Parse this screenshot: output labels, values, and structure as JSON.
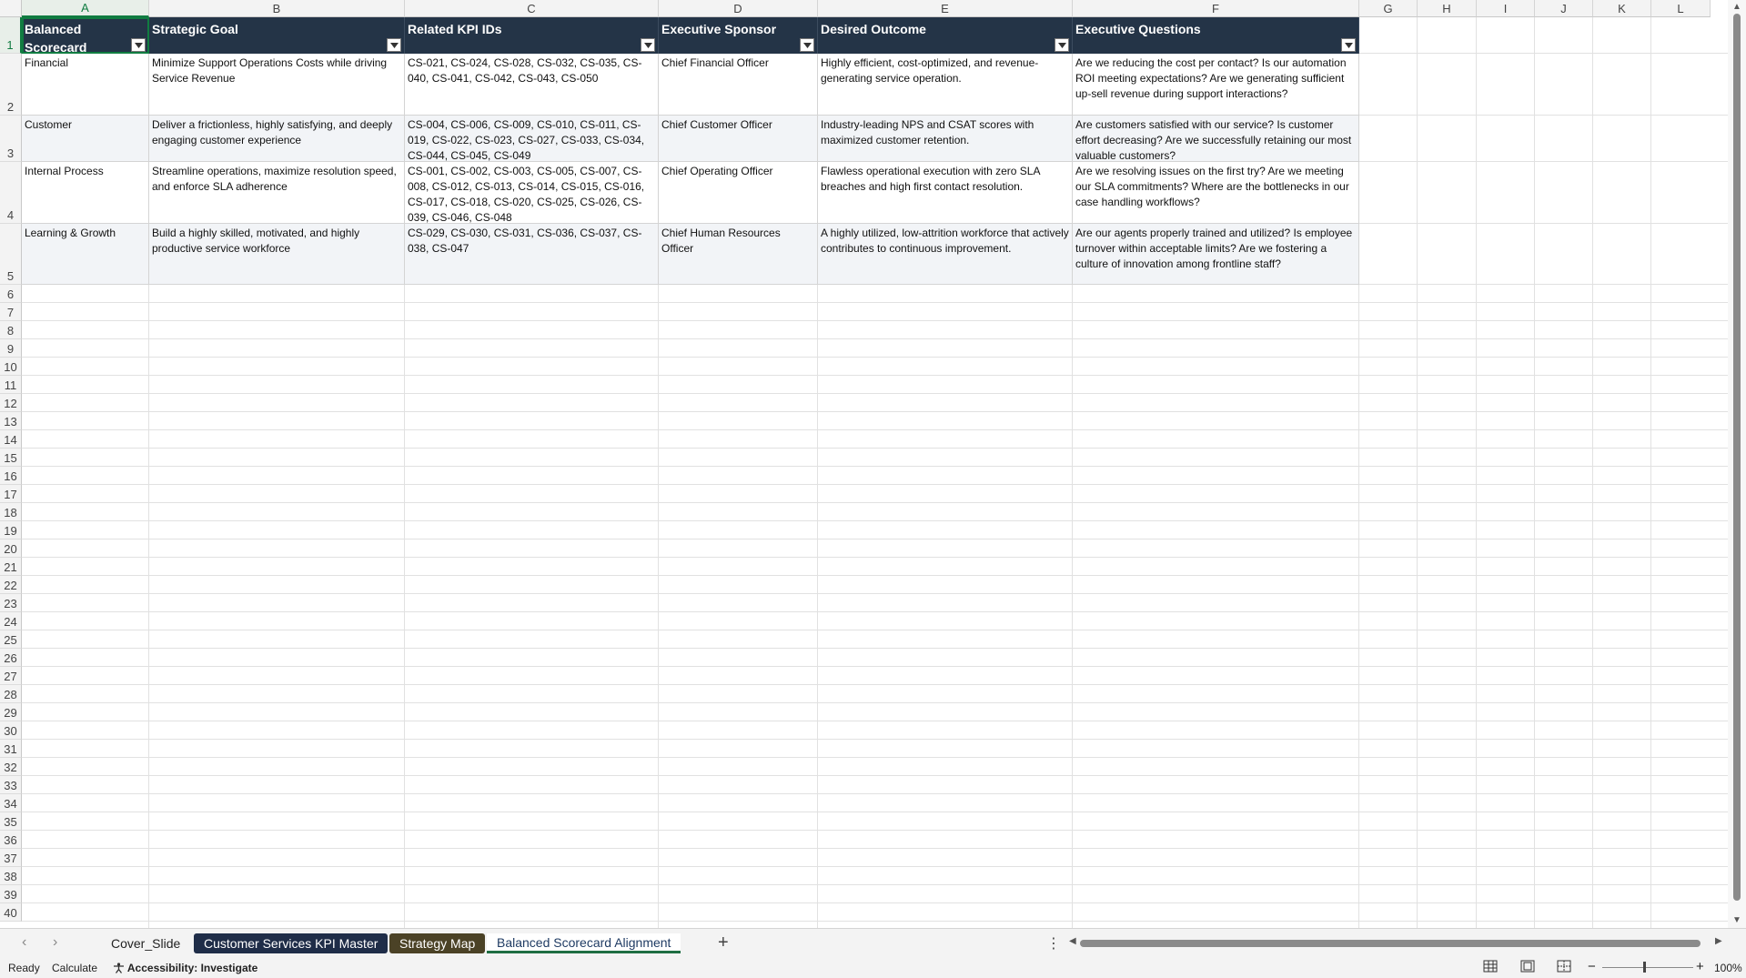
{
  "columns": [
    "A",
    "B",
    "C",
    "D",
    "E",
    "F",
    "G",
    "H",
    "I",
    "J",
    "K",
    "L"
  ],
  "rows": [
    "1",
    "2",
    "3",
    "4",
    "5",
    "6",
    "7",
    "8",
    "9",
    "10",
    "11",
    "12",
    "13",
    "14",
    "15",
    "16",
    "17",
    "18",
    "19",
    "20",
    "21",
    "22",
    "23",
    "24",
    "25",
    "26",
    "27",
    "28",
    "29",
    "30",
    "31",
    "32",
    "33",
    "34",
    "35",
    "36",
    "37",
    "38",
    "39",
    "40"
  ],
  "table": {
    "headers": [
      "Balanced Scorecard Perspective",
      "Strategic Goal",
      "Related KPI IDs",
      "Executive Sponsor",
      "Desired Outcome",
      "Executive Questions"
    ],
    "data": [
      [
        "Financial",
        "Minimize Support Operations Costs while driving Service Revenue",
        "CS-021, CS-024, CS-028, CS-032, CS-035, CS-040, CS-041, CS-042, CS-043, CS-050",
        "Chief Financial Officer",
        "Highly efficient, cost-optimized, and revenue-generating service operation.",
        "Are we reducing the cost per contact? Is our automation ROI meeting expectations? Are we generating sufficient up-sell revenue during support interactions?"
      ],
      [
        "Customer",
        "Deliver a frictionless, highly satisfying, and deeply engaging customer experience",
        "CS-004, CS-006, CS-009, CS-010, CS-011, CS-019, CS-022, CS-023, CS-027, CS-033, CS-034, CS-044, CS-045, CS-049",
        "Chief Customer Officer",
        "Industry-leading NPS and CSAT scores with maximized customer retention.",
        "Are customers satisfied with our service? Is customer effort decreasing? Are we successfully retaining our most valuable customers?"
      ],
      [
        "Internal Process",
        "Streamline operations, maximize resolution speed, and enforce SLA adherence",
        "CS-001, CS-002, CS-003, CS-005, CS-007, CS-008, CS-012, CS-013, CS-014, CS-015, CS-016, CS-017, CS-018, CS-020, CS-025, CS-026, CS-039, CS-046, CS-048",
        "Chief Operating Officer",
        "Flawless operational execution with zero SLA breaches and high first contact resolution.",
        "Are we resolving issues on the first try? Are we meeting our SLA commitments? Where are the bottlenecks in our case handling workflows?"
      ],
      [
        "Learning & Growth",
        "Build a highly skilled, motivated, and highly productive service workforce",
        "CS-029, CS-030, CS-031, CS-036, CS-037, CS-038, CS-047",
        "Chief Human Resources Officer",
        "A highly utilized, low-attrition workforce that actively contributes to continuous improvement.",
        "Are our agents properly trained and utilized? Is employee turnover within acceptable limits? Are we fostering a culture of innovation among frontline staff?"
      ]
    ]
  },
  "sheet_tabs": [
    {
      "label": "Cover_Slide",
      "style": "plain"
    },
    {
      "label": "Customer Services KPI Master",
      "style": "navy"
    },
    {
      "label": "Strategy Map",
      "style": "olive"
    },
    {
      "label": "Balanced Scorecard Alignment",
      "style": "active"
    }
  ],
  "add_sheet_label": "+",
  "status": {
    "ready": "Ready",
    "calculate": "Calculate",
    "accessibility": "Accessibility: Investigate",
    "zoom": "100%",
    "zoom_minus": "−",
    "zoom_plus": "+"
  },
  "colors": {
    "header_fill": "#243447",
    "band_fill": "#f2f4f7",
    "selection": "#107c41",
    "tab_navy": "#1f2d48",
    "tab_olive": "#4b4226"
  }
}
